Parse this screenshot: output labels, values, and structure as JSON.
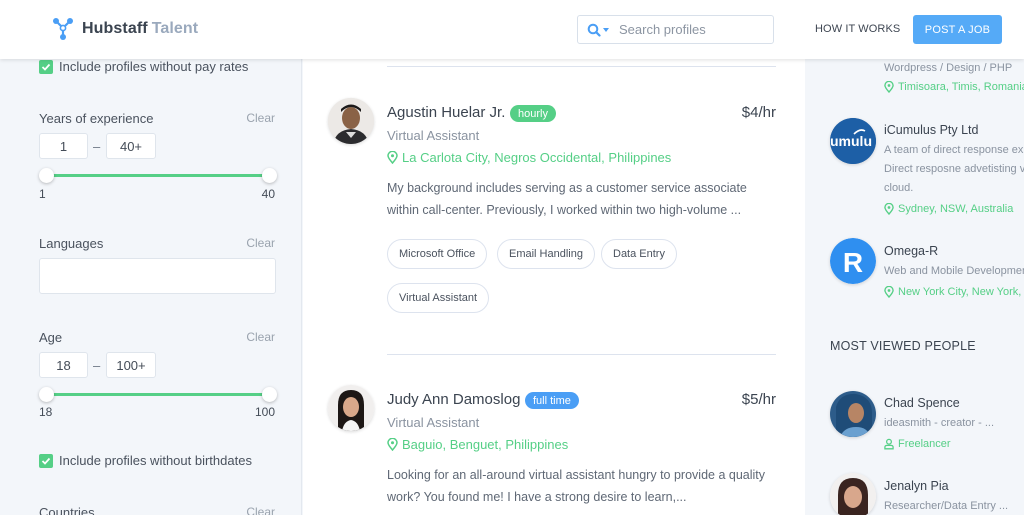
{
  "header": {
    "logo_brand": "Hubstaff",
    "logo_product": "Talent",
    "search_placeholder": "Search profiles",
    "nav_how_it_works": "HOW IT WORKS",
    "post_job_label": "POST A JOB"
  },
  "filters": {
    "include_no_pay_rates": "Include profiles without pay rates",
    "experience": {
      "label": "Years of experience",
      "clear": "Clear",
      "min_value": "1",
      "max_value": "40+",
      "dash": "–",
      "range_min_label": "1",
      "range_max_label": "40"
    },
    "languages": {
      "label": "Languages",
      "clear": "Clear",
      "value": ""
    },
    "age": {
      "label": "Age",
      "clear": "Clear",
      "min_value": "18",
      "max_value": "100+",
      "dash": "–",
      "range_min_label": "18",
      "range_max_label": "100"
    },
    "include_no_birthdates": "Include profiles without birthdates",
    "countries": {
      "label": "Countries",
      "clear": "Clear"
    }
  },
  "profiles": [
    {
      "name": "Agustin Huelar Jr.",
      "badge": "hourly",
      "badge_color": "#55cf86",
      "rate": "$4/hr",
      "role": "Virtual Assistant",
      "location": "La Carlota City, Negros Occidental, Philippines",
      "bio_line1": "My background includes serving as a customer service associate",
      "bio_line2": "within call-center. Previously, I worked within two high-volume ...",
      "skills": [
        "Microsoft Office",
        "Email Handling",
        "Data Entry",
        "Virtual Assistant"
      ]
    },
    {
      "name": "Judy Ann Damoslog",
      "badge": "full time",
      "badge_color": "#4a9ef5",
      "rate": "$5/hr",
      "role": "Virtual Assistant",
      "location": "Baguio, Benguet, Philippines",
      "bio_line1": "Looking for an all-around virtual assistant hungry to provide a quality",
      "bio_line2": "work? You found me! I have a strong desire to learn,..."
    }
  ],
  "companies": [
    {
      "desc": "Wordpress / Design / PHP",
      "location": "Timisoara, Timis, Romania"
    },
    {
      "name": "iCumulus Pty Ltd",
      "logo_text": "umulu",
      "desc_line1": "A team of direct response exp",
      "desc_line2": "Direct resposne advetisting v",
      "desc_line3": "cloud.",
      "location": "Sydney, NSW, Australia"
    },
    {
      "name": "Omega-R",
      "logo_letter": "R",
      "desc": "Web and Mobile Developmen",
      "location": "New York City, New York, U"
    }
  ],
  "most_viewed": {
    "title": "MOST VIEWED PEOPLE",
    "people": [
      {
        "name": "Chad Spence",
        "desc": "ideasmith - creator - ...",
        "type": "Freelancer"
      },
      {
        "name": "Jenalyn Pia",
        "desc": "Researcher/Data Entry ..."
      }
    ]
  },
  "colors": {
    "accent_green": "#55cf86",
    "accent_blue": "#4a9ef5",
    "post_job_bg": "#55aaf7"
  }
}
